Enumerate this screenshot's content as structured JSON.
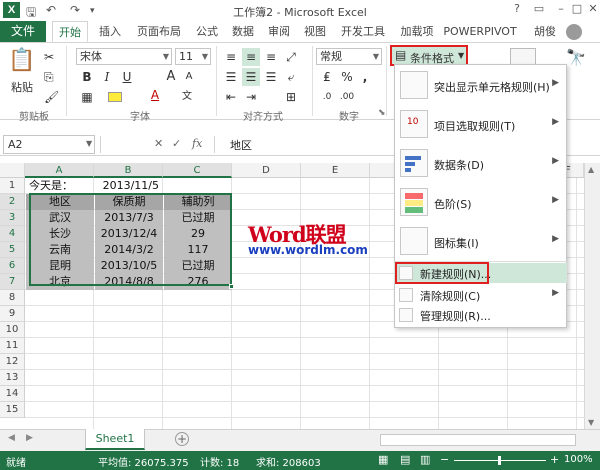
{
  "window": {
    "title": "工作簿2 - Microsoft Excel",
    "user": "胡俊",
    "help": "?"
  },
  "tabs": [
    "文件",
    "开始",
    "插入",
    "页面布局",
    "公式",
    "数据",
    "审阅",
    "视图",
    "开发工具",
    "加载项",
    "POWERPIVOT"
  ],
  "ribbon": {
    "paste": "粘贴",
    "clipboard": "剪贴板",
    "font_group": "字体",
    "align_group": "对齐方式",
    "number_group": "数字",
    "font_name": "宋体",
    "font_size": "11",
    "number_format": "常规",
    "cond_format": "条件格式",
    "bold": "B",
    "italic": "I",
    "underline": "U",
    "grow": "A",
    "shrink": "A",
    "fontcolor": "A",
    "pct": "%",
    "comma": ","
  },
  "formula": {
    "namebox": "A2",
    "fx": "fx",
    "content": "地区"
  },
  "columns": [
    "A",
    "B",
    "C",
    "D",
    "E",
    "F"
  ],
  "rows": [
    "1",
    "2",
    "3",
    "4",
    "5",
    "6",
    "7",
    "8",
    "9",
    "10",
    "11",
    "12",
    "13",
    "14",
    "15"
  ],
  "sheet": {
    "a1": "今天是：",
    "b1": "2013/11/5",
    "table": [
      [
        "地区",
        "保质期",
        "辅助列"
      ],
      [
        "武汉",
        "2013/7/3",
        "已过期"
      ],
      [
        "长沙",
        "2013/12/4",
        "29"
      ],
      [
        "云南",
        "2014/3/2",
        "117"
      ],
      [
        "昆明",
        "2013/10/5",
        "已过期"
      ],
      [
        "北京",
        "2014/8/8",
        "276"
      ]
    ]
  },
  "watermark": {
    "line1": "Word联盟",
    "line2": "www.wordlm.com"
  },
  "menu": {
    "items": [
      {
        "label": "突出显示单元格规则(H)"
      },
      {
        "label": "项目选取规则(T)"
      },
      {
        "label": "数据条(D)"
      },
      {
        "label": "色阶(S)"
      },
      {
        "label": "图标集(I)"
      }
    ],
    "new_rule": "新建规则(N)...",
    "clear_rules": "清除规则(C)",
    "manage_rules": "管理规则(R)..."
  },
  "sheet_tab": "Sheet1",
  "status": {
    "mode": "就绪",
    "average": "平均值: 26075.375",
    "count": "计数: 18",
    "sum": "求和: 208603",
    "zoom": "100%"
  },
  "colors": {
    "accent": "#217346",
    "highlight_box": "#e02020"
  }
}
